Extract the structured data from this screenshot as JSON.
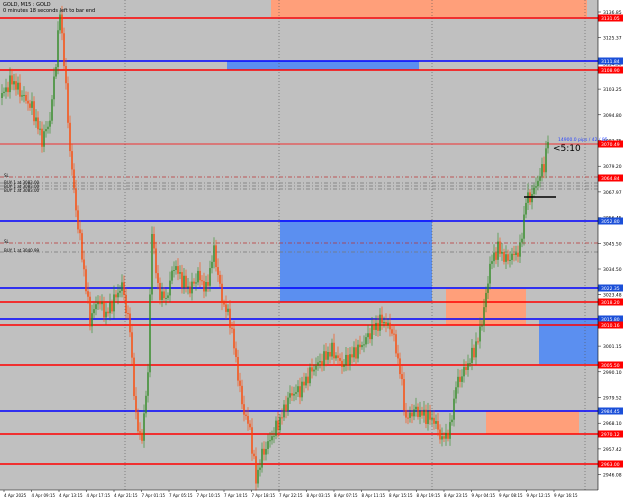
{
  "header": {
    "symbol": "GOLD, M15 : GOLD",
    "timer_note": "0 minutes 18 seconds left to bar end"
  },
  "order_lines": [
    {
      "label": "SL"
    },
    {
      "label": "BUY 1 at 3083.00"
    },
    {
      "label": "BUY 1 at 3083.00"
    },
    {
      "label": "BUY 1 at 3083.00"
    },
    {
      "label": "SL"
    },
    {
      "label": "BUY 1 at 3040.99"
    }
  ],
  "bar_timer": "<5:10",
  "last_price_text": "14900.0 pips / 42 / 85",
  "price_axis": {
    "ticks": [
      "3136.85",
      "3125.37",
      "3114.30",
      "3103.25",
      "3094.80",
      "3083.75",
      "3079.20",
      "3067.97",
      "3056.45",
      "3045.50",
      "3034.50",
      "3023.48",
      "3012.12",
      "3001.15",
      "2990.10",
      "2979.52",
      "2968.10",
      "2957.42",
      "2946.08"
    ],
    "labels": [
      "3131.05",
      "3111.84",
      "3108.90",
      "3070.49",
      "3064.84",
      "3052.80",
      "3022.35",
      "3018.20",
      "3015.80",
      "3010.16",
      "3005.50",
      "2984.45",
      "2970.12",
      "2963.00"
    ]
  },
  "time_axis": {
    "labels": [
      "4 Apr 2025",
      "4 Apr 09:15",
      "4 Apr 13:15",
      "4 Apr 17:15",
      "4 Apr 21:15",
      "7 Apr 01:15",
      "7 Apr 05:15",
      "7 Apr 10:15",
      "7 Apr 14:15",
      "7 Apr 18:15",
      "7 Apr 22:15",
      "8 Apr 03:15",
      "8 Apr 07:15",
      "8 Apr 11:15",
      "8 Apr 15:15",
      "8 Apr 19:15",
      "8 Apr 23:15",
      "9 Apr 04:15",
      "9 Apr 08:15",
      "9 Apr 12:15",
      "9 Apr 16:15"
    ]
  },
  "colors": {
    "background": "#c0c0c0",
    "bull_candle": "#2e8b22",
    "bear_candle": "#ff4500",
    "supply_zone": "#ff9f7a",
    "demand_zone": "#5b8ff0",
    "resistance_line": "#ff0000",
    "support_line": "#0000ff",
    "level_label_red": "#ff0000",
    "level_label_blue": "#1b4fd8"
  }
}
